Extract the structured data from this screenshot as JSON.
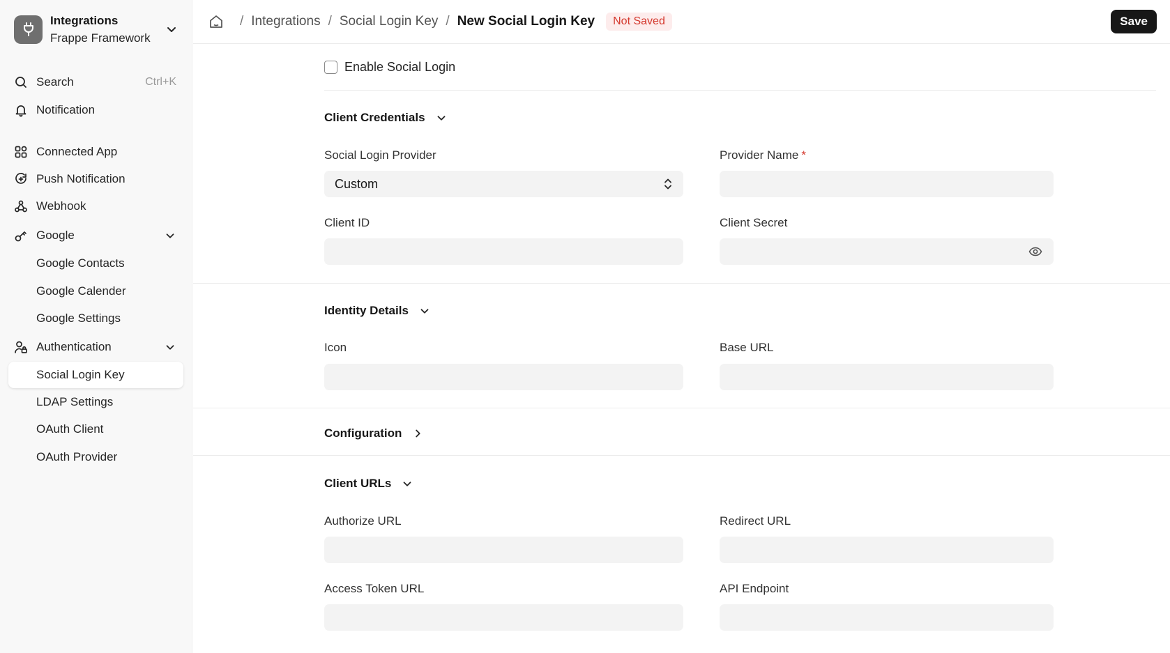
{
  "app": {
    "title": "Integrations",
    "subtitle": "Frappe Framework"
  },
  "sidebar": {
    "search": {
      "label": "Search",
      "shortcut": "Ctrl+K"
    },
    "notification": {
      "label": "Notification"
    },
    "items": [
      {
        "label": "Connected App",
        "icon": "connected-app-icon"
      },
      {
        "label": "Push Notification",
        "icon": "push-notification-icon"
      },
      {
        "label": "Webhook",
        "icon": "webhook-icon"
      },
      {
        "label": "Google",
        "icon": "google-key-icon",
        "expanded": true
      },
      {
        "label": "Google Contacts"
      },
      {
        "label": "Google Calender"
      },
      {
        "label": "Google Settings"
      },
      {
        "label": "Authentication",
        "icon": "user-lock-icon",
        "expanded": true
      },
      {
        "label": "Social Login Key",
        "active": true
      },
      {
        "label": "LDAP Settings"
      },
      {
        "label": "OAuth Client"
      },
      {
        "label": "OAuth Provider"
      }
    ]
  },
  "header": {
    "breadcrumbs": [
      "Integrations",
      "Social Login Key"
    ],
    "current": "New Social Login Key",
    "status": "Not Saved",
    "save_label": "Save",
    "status_color": "#d4372c"
  },
  "form": {
    "enable_label": "Enable Social Login",
    "enable_checked": false,
    "sections": {
      "client_credentials": "Client Credentials",
      "identity_details": "Identity Details",
      "configuration": "Configuration",
      "client_urls": "Client URLs"
    },
    "fields": {
      "provider": {
        "label": "Social Login Provider",
        "value": "Custom"
      },
      "provider_name": {
        "label": "Provider Name",
        "required": "*",
        "value": ""
      },
      "client_id": {
        "label": "Client ID",
        "value": ""
      },
      "client_secret": {
        "label": "Client Secret",
        "value": ""
      },
      "icon": {
        "label": "Icon",
        "value": ""
      },
      "base_url": {
        "label": "Base URL",
        "value": ""
      },
      "authorize_url": {
        "label": "Authorize URL",
        "value": ""
      },
      "redirect_url": {
        "label": "Redirect URL",
        "value": ""
      },
      "access_token_url": {
        "label": "Access Token URL",
        "value": ""
      },
      "api_endpoint": {
        "label": "API Endpoint",
        "value": ""
      }
    }
  }
}
